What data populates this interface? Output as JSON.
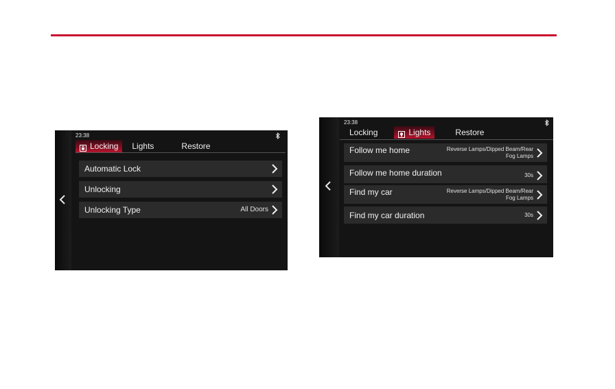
{
  "left_screen": {
    "time": "23:38",
    "tabs": [
      {
        "label": "Locking",
        "active": true
      },
      {
        "label": "Lights",
        "active": false
      },
      {
        "label": "Restore",
        "active": false
      }
    ],
    "rows": [
      {
        "label": "Automatic Lock",
        "value": ""
      },
      {
        "label": "Unlocking",
        "value": ""
      },
      {
        "label": "Unlocking Type",
        "value": "All Doors"
      }
    ]
  },
  "right_screen": {
    "time": "23:38",
    "tabs": [
      {
        "label": "Locking",
        "active": false
      },
      {
        "label": "Lights",
        "active": true
      },
      {
        "label": "Restore",
        "active": false
      }
    ],
    "rows": [
      {
        "label": "Follow me home",
        "value_line1": "Reverse Lamps/Dipped Beam/Rear",
        "value_line2": "Fog Lamps"
      },
      {
        "label": "Follow me home duration",
        "value_line1": "30s",
        "value_line2": ""
      },
      {
        "label": "Find my car",
        "value_line1": "Reverse Lamps/Dipped Beam/Rear",
        "value_line2": "Fog Lamps"
      },
      {
        "label": "Find my car duration",
        "value_line1": "30s",
        "value_line2": ""
      }
    ]
  },
  "colors": {
    "accent": "#c8102e",
    "screen_bg": "#141414",
    "row_bg": "#2b2b2b"
  },
  "icons": [
    "back-chevron-icon",
    "bluetooth-icon",
    "lock-icon",
    "bulb-icon",
    "chevron-right-icon"
  ]
}
